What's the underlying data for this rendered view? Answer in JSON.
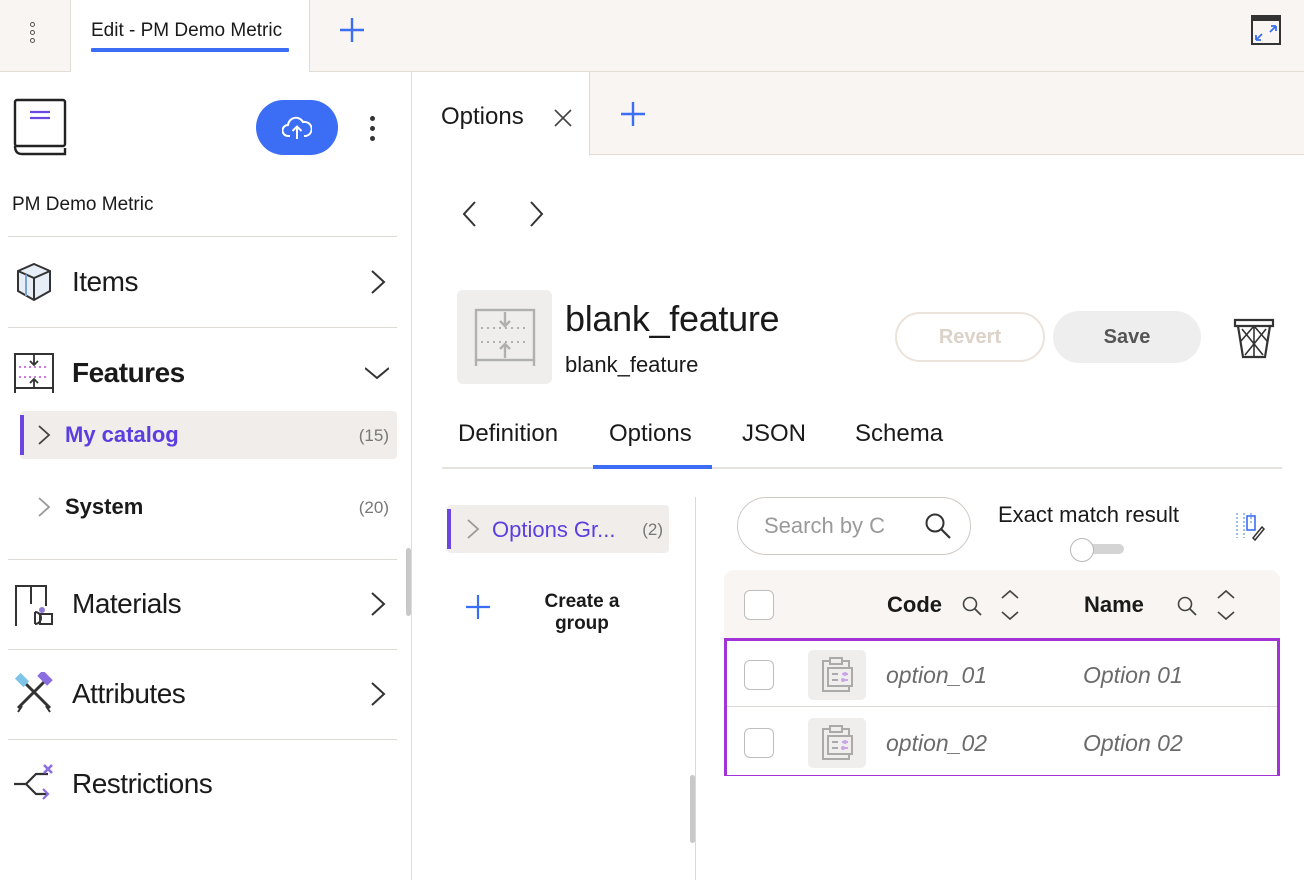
{
  "topbar": {
    "tab_label": "Edit - PM Demo Metric"
  },
  "sidebar": {
    "catalog_name": "PM Demo Metric",
    "nav": {
      "items": "Items",
      "features": "Features",
      "materials": "Materials",
      "attributes": "Attributes",
      "restrictions": "Restrictions"
    },
    "sub_items": [
      {
        "label": "My catalog",
        "count": "(15)"
      },
      {
        "label": "System",
        "count": "(20)"
      }
    ]
  },
  "main": {
    "tab_label": "Options",
    "feature": {
      "title": "blank_feature",
      "subtitle": "blank_feature"
    },
    "buttons": {
      "revert": "Revert",
      "save": "Save"
    },
    "sub_tabs": {
      "definition": "Definition",
      "options": "Options",
      "json": "JSON",
      "schema": "Schema"
    },
    "group": {
      "label": "Options Gr...",
      "count": "(2)"
    },
    "create_group": "Create a group",
    "search": {
      "placeholder": "Search by Code or Name",
      "value": ""
    },
    "exact_match_label": "Exact match result",
    "exact_match_on": false,
    "table": {
      "headers": {
        "code": "Code",
        "name": "Name"
      },
      "rows": [
        {
          "code": "option_01",
          "name": "Option 01"
        },
        {
          "code": "option_02",
          "name": "Option 02"
        }
      ]
    }
  },
  "colors": {
    "accent_blue": "#3b6ef5",
    "accent_purple": "#5b3ee0",
    "selection_border": "#a233d4",
    "tab_bar_bg": "#f8f5f2"
  }
}
